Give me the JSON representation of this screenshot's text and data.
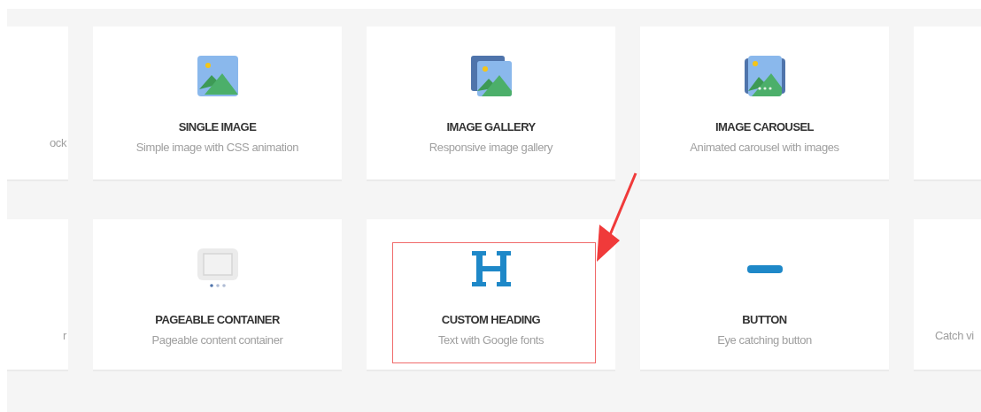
{
  "rows": [
    {
      "cards": [
        {
          "kind": "partial-left",
          "description": "ock"
        },
        {
          "kind": "single-image",
          "title": "SINGLE IMAGE",
          "description": "Simple image with CSS animation",
          "highlighted": false
        },
        {
          "kind": "image-gallery",
          "title": "IMAGE GALLERY",
          "description": "Responsive image gallery",
          "highlighted": false
        },
        {
          "kind": "image-carousel",
          "title": "IMAGE CAROUSEL",
          "description": "Animated carousel with images",
          "highlighted": false
        },
        {
          "kind": "partial-right"
        }
      ]
    },
    {
      "cards": [
        {
          "kind": "partial-left",
          "description": "r"
        },
        {
          "kind": "pageable-container",
          "title": "PAGEABLE CONTAINER",
          "description": "Pageable content container",
          "highlighted": false
        },
        {
          "kind": "custom-heading",
          "title": "CUSTOM HEADING",
          "description": "Text with Google fonts",
          "highlighted": true
        },
        {
          "kind": "button",
          "title": "BUTTON",
          "description": "Eye catching button",
          "highlighted": false
        },
        {
          "kind": "partial-right",
          "description": "Catch vi"
        }
      ]
    }
  ],
  "annotation": {
    "arrow": true
  }
}
